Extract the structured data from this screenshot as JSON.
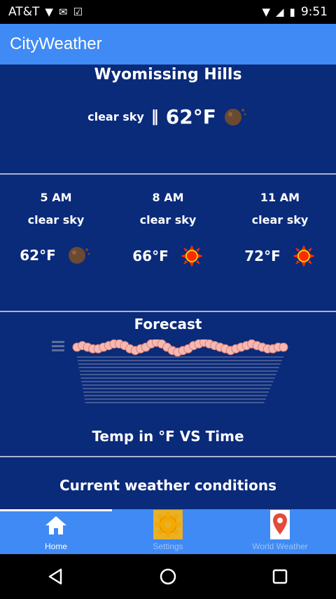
{
  "status_bar": {
    "carrier": "AT&T",
    "time": "9:51"
  },
  "app": {
    "title": "CityWeather"
  },
  "current": {
    "city": "Wyomissing Hills",
    "desc": "clear sky",
    "separator": "‖",
    "temp": "62°F",
    "icon": "moon-icon"
  },
  "hourly": [
    {
      "time": "5 AM",
      "desc": "clear sky",
      "temp": "62°F",
      "icon": "moon-icon"
    },
    {
      "time": "8 AM",
      "desc": "clear sky",
      "temp": "66°F",
      "icon": "sun-icon"
    },
    {
      "time": "11 AM",
      "desc": "clear sky",
      "temp": "72°F",
      "icon": "sun-icon"
    }
  ],
  "forecast": {
    "title": "Forecast",
    "chart_caption": "Temp in °F VS Time"
  },
  "current_conditions": {
    "title": "Current weather conditions"
  },
  "tabs": [
    {
      "label": "Home",
      "icon": "home-icon",
      "active": true
    },
    {
      "label": "Settings",
      "icon": "gear-icon",
      "active": false
    },
    {
      "label": "World Weather",
      "icon": "map-pin-icon",
      "active": false
    }
  ],
  "colors": {
    "app_bar": "#3f8af5",
    "background": "#0a2a7a",
    "chart_line": "#f3b9b2",
    "sun": "#ff2a00",
    "moon": "#6b4a32"
  },
  "chart_data": {
    "type": "line",
    "title": "",
    "xlabel": "",
    "ylabel": "",
    "x": [
      0,
      1,
      2,
      3,
      4,
      5,
      6,
      7,
      8,
      9,
      10,
      11,
      12,
      13,
      14,
      15,
      16,
      17,
      18,
      19,
      20,
      21,
      22,
      23,
      24,
      25,
      26,
      27,
      28,
      29,
      30,
      31,
      32,
      33,
      34,
      35,
      36,
      37,
      38,
      39
    ],
    "series": [
      {
        "values": [
          62,
          63,
          62,
          61,
          61,
          62,
          63,
          64,
          64,
          63,
          61,
          60,
          61,
          62,
          64,
          65,
          64,
          62,
          60,
          59,
          60,
          61,
          63,
          64,
          65,
          64,
          63,
          62,
          61,
          60,
          61,
          62,
          63,
          64,
          63,
          62,
          61,
          61,
          62,
          62
        ]
      }
    ]
  }
}
